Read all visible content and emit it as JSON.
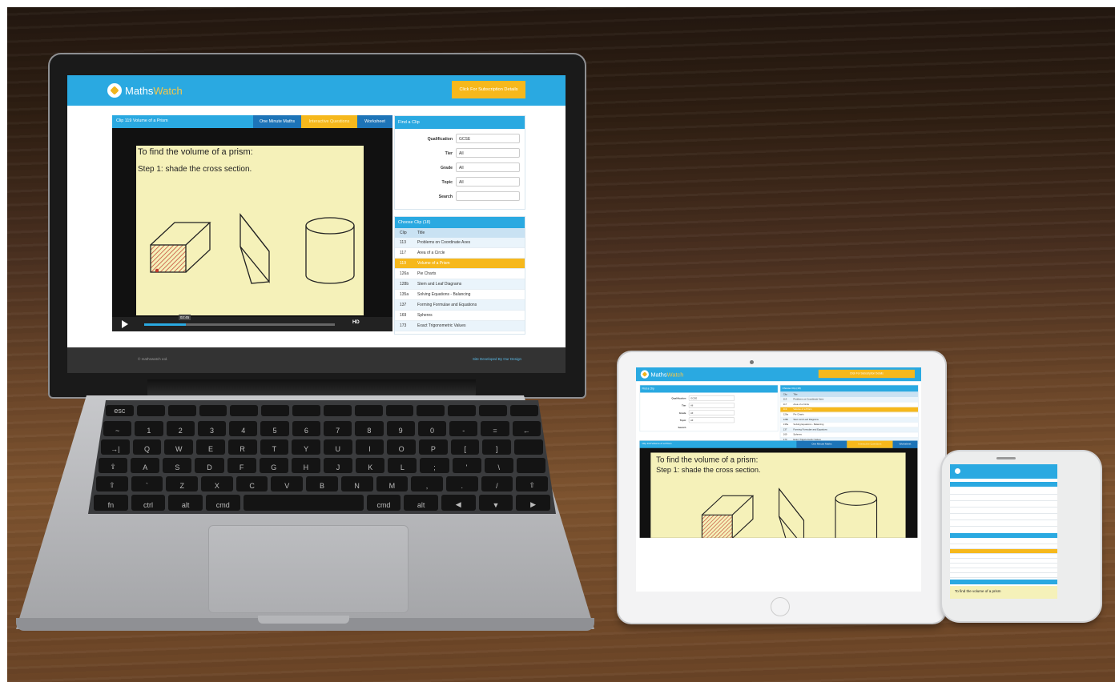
{
  "app": {
    "logo_prefix": "Maths",
    "logo_suffix": "Watch",
    "subscription_button": "Click For Subscription Details",
    "video_panel": {
      "title": "Clip 119 Volume of a Prism",
      "tabs": [
        "One Minute Maths",
        "Interactive Questions",
        "Worksheet"
      ],
      "active_tab": "Interactive Questions",
      "line1": "To find the volume of a prism:",
      "line2": "Step 1:  shade the cross section.",
      "time_tooltip": "02:45",
      "progress": 0.22,
      "hd_label": "HD"
    },
    "find_clip": {
      "title": "Find a Clip",
      "fields": [
        {
          "label": "Qualification",
          "value": "GCSE"
        },
        {
          "label": "Tier",
          "value": "All"
        },
        {
          "label": "Grade",
          "value": "All"
        },
        {
          "label": "Topic",
          "value": "All"
        },
        {
          "label": "Search",
          "value": ""
        }
      ]
    },
    "choose_clip": {
      "title": "Choose Clip (18)",
      "col_clip": "Clip",
      "col_title": "Title",
      "rows": [
        {
          "clip": "113",
          "title": "Problems on Coordinate Axes"
        },
        {
          "clip": "117",
          "title": "Area of a Circle"
        },
        {
          "clip": "119",
          "title": "Volume of a Prism"
        },
        {
          "clip": "126a",
          "title": "Pie Charts"
        },
        {
          "clip": "128b",
          "title": "Stem and Leaf Diagrams"
        },
        {
          "clip": "135a",
          "title": "Solving Equations - Balancing"
        },
        {
          "clip": "137",
          "title": "Forming Formulae and Equations"
        },
        {
          "clip": "169",
          "title": "Spheres"
        },
        {
          "clip": "173",
          "title": "Exact Trigonometric Values"
        }
      ],
      "selected_clip": "119"
    },
    "footer_left": "© mathswatch Ltd.",
    "footer_right": "Site Developed By Our Design"
  },
  "phone_bottom_text": "To find the volume of a prism",
  "colors": {
    "brand_blue": "#2aa9e1",
    "accent_yellow": "#f6b81c",
    "board_yellow": "#f5f1b9"
  },
  "keyboard": {
    "row1": [
      "esc",
      "",
      "",
      "",
      "",
      "",
      "",
      "",
      "",
      "",
      "",
      "",
      "",
      ""
    ],
    "row2": [
      "~",
      "1",
      "2",
      "3",
      "4",
      "5",
      "6",
      "7",
      "8",
      "9",
      "0",
      "-",
      "=",
      "←"
    ],
    "row3": [
      "→|",
      "Q",
      "W",
      "E",
      "R",
      "T",
      "Y",
      "U",
      "I",
      "O",
      "P",
      "[",
      "]",
      ""
    ],
    "row4": [
      "⇪",
      "A",
      "S",
      "D",
      "F",
      "G",
      "H",
      "J",
      "K",
      "L",
      ";",
      "'",
      "\\",
      ""
    ],
    "row5": [
      "⇧",
      "`",
      "Z",
      "X",
      "C",
      "V",
      "B",
      "N",
      "M",
      ",",
      ".",
      "/",
      "⇧"
    ],
    "row6": [
      "fn",
      "ctrl",
      "alt",
      "cmd",
      "",
      "cmd",
      "alt",
      "◀",
      "▼",
      "▶"
    ]
  }
}
